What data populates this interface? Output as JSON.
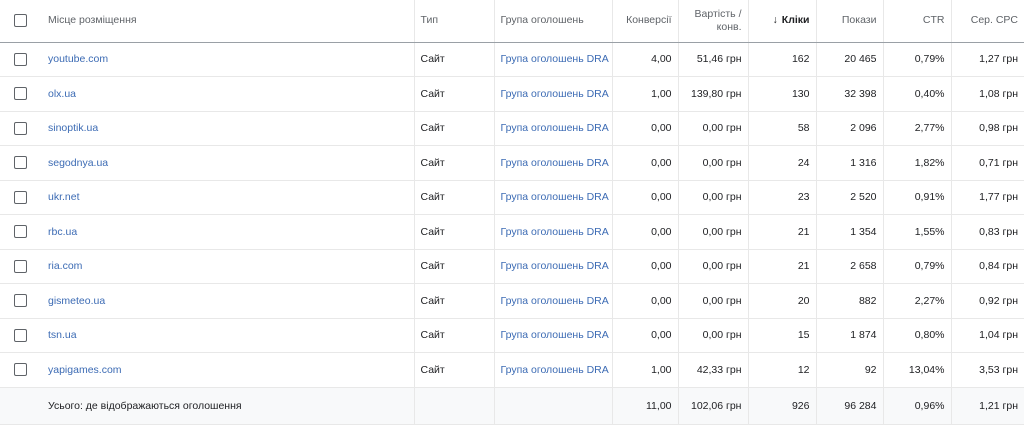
{
  "columns": {
    "placement": "Місце розміщення",
    "type": "Тип",
    "ad_group": "Група оголошень",
    "conversions": "Конверсії",
    "cost_per_conv": "Вартість / конв.",
    "clicks": "Кліки",
    "impressions": "Покази",
    "ctr": "CTR",
    "avg_cpc": "Сер. CPC"
  },
  "rows": [
    {
      "placement": "youtube.com",
      "type": "Сайт",
      "ad_group": "Група оголошень DRA",
      "conversions": "4,00",
      "cost_per_conv": "51,46 грн",
      "clicks": "162",
      "impressions": "20 465",
      "ctr": "0,79%",
      "avg_cpc": "1,27 грн"
    },
    {
      "placement": "olx.ua",
      "type": "Сайт",
      "ad_group": "Група оголошень DRA",
      "conversions": "1,00",
      "cost_per_conv": "139,80 грн",
      "clicks": "130",
      "impressions": "32 398",
      "ctr": "0,40%",
      "avg_cpc": "1,08 грн"
    },
    {
      "placement": "sinoptik.ua",
      "type": "Сайт",
      "ad_group": "Група оголошень DRA",
      "conversions": "0,00",
      "cost_per_conv": "0,00 грн",
      "clicks": "58",
      "impressions": "2 096",
      "ctr": "2,77%",
      "avg_cpc": "0,98 грн"
    },
    {
      "placement": "segodnya.ua",
      "type": "Сайт",
      "ad_group": "Група оголошень DRA",
      "conversions": "0,00",
      "cost_per_conv": "0,00 грн",
      "clicks": "24",
      "impressions": "1 316",
      "ctr": "1,82%",
      "avg_cpc": "0,71 грн"
    },
    {
      "placement": "ukr.net",
      "type": "Сайт",
      "ad_group": "Група оголошень DRA",
      "conversions": "0,00",
      "cost_per_conv": "0,00 грн",
      "clicks": "23",
      "impressions": "2 520",
      "ctr": "0,91%",
      "avg_cpc": "1,77 грн"
    },
    {
      "placement": "rbc.ua",
      "type": "Сайт",
      "ad_group": "Група оголошень DRA",
      "conversions": "0,00",
      "cost_per_conv": "0,00 грн",
      "clicks": "21",
      "impressions": "1 354",
      "ctr": "1,55%",
      "avg_cpc": "0,83 грн"
    },
    {
      "placement": "ria.com",
      "type": "Сайт",
      "ad_group": "Група оголошень DRA",
      "conversions": "0,00",
      "cost_per_conv": "0,00 грн",
      "clicks": "21",
      "impressions": "2 658",
      "ctr": "0,79%",
      "avg_cpc": "0,84 грн"
    },
    {
      "placement": "gismeteo.ua",
      "type": "Сайт",
      "ad_group": "Група оголошень DRA",
      "conversions": "0,00",
      "cost_per_conv": "0,00 грн",
      "clicks": "20",
      "impressions": "882",
      "ctr": "2,27%",
      "avg_cpc": "0,92 грн"
    },
    {
      "placement": "tsn.ua",
      "type": "Сайт",
      "ad_group": "Група оголошень DRA",
      "conversions": "0,00",
      "cost_per_conv": "0,00 грн",
      "clicks": "15",
      "impressions": "1 874",
      "ctr": "0,80%",
      "avg_cpc": "1,04 грн"
    },
    {
      "placement": "yapigames.com",
      "type": "Сайт",
      "ad_group": "Група оголошень DRA",
      "conversions": "1,00",
      "cost_per_conv": "42,33 грн",
      "clicks": "12",
      "impressions": "92",
      "ctr": "13,04%",
      "avg_cpc": "3,53 грн"
    }
  ],
  "total": {
    "label": "Усього: де відображаються оголошення",
    "conversions": "11,00",
    "cost_per_conv": "102,06 грн",
    "clicks": "926",
    "impressions": "96 284",
    "ctr": "0,96%",
    "avg_cpc": "1,21 грн"
  },
  "sort_icon": "arrow-down-icon",
  "colors": {
    "link": "#3c6bb4",
    "total_bg": "#f8f9fa"
  }
}
